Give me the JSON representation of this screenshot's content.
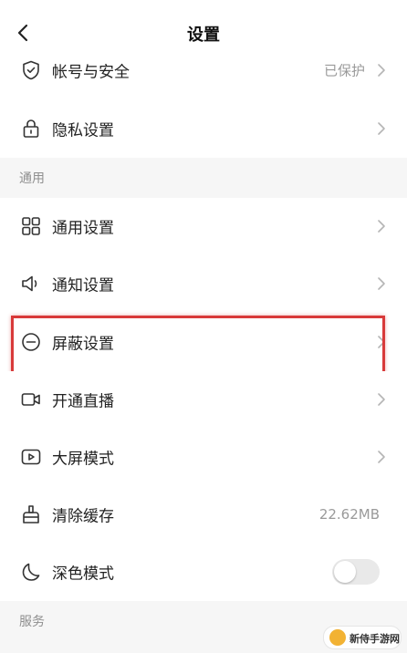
{
  "header": {
    "title": "设置"
  },
  "account": {
    "items": [
      {
        "label": "帐号与安全",
        "value": "已保护",
        "icon": "shield-check-icon"
      },
      {
        "label": "隐私设置",
        "icon": "lock-icon"
      }
    ]
  },
  "general": {
    "section_title": "通用",
    "items": [
      {
        "label": "通用设置",
        "icon": "grid-icon"
      },
      {
        "label": "通知设置",
        "icon": "speaker-icon"
      },
      {
        "label": "屏蔽设置",
        "icon": "block-icon"
      },
      {
        "label": "开通直播",
        "icon": "video-camera-icon"
      },
      {
        "label": "大屏模式",
        "icon": "play-screen-icon"
      },
      {
        "label": "清除缓存",
        "value": "22.62MB",
        "icon": "broom-icon"
      },
      {
        "label": "深色模式",
        "icon": "moon-icon",
        "toggle": false
      }
    ]
  },
  "services": {
    "section_title": "服务"
  },
  "watermark": {
    "text": "新侍手游网"
  },
  "colors": {
    "highlight": "#d83a3a",
    "section_bg": "#f6f6f6",
    "secondary_text": "#9a9a9a"
  }
}
